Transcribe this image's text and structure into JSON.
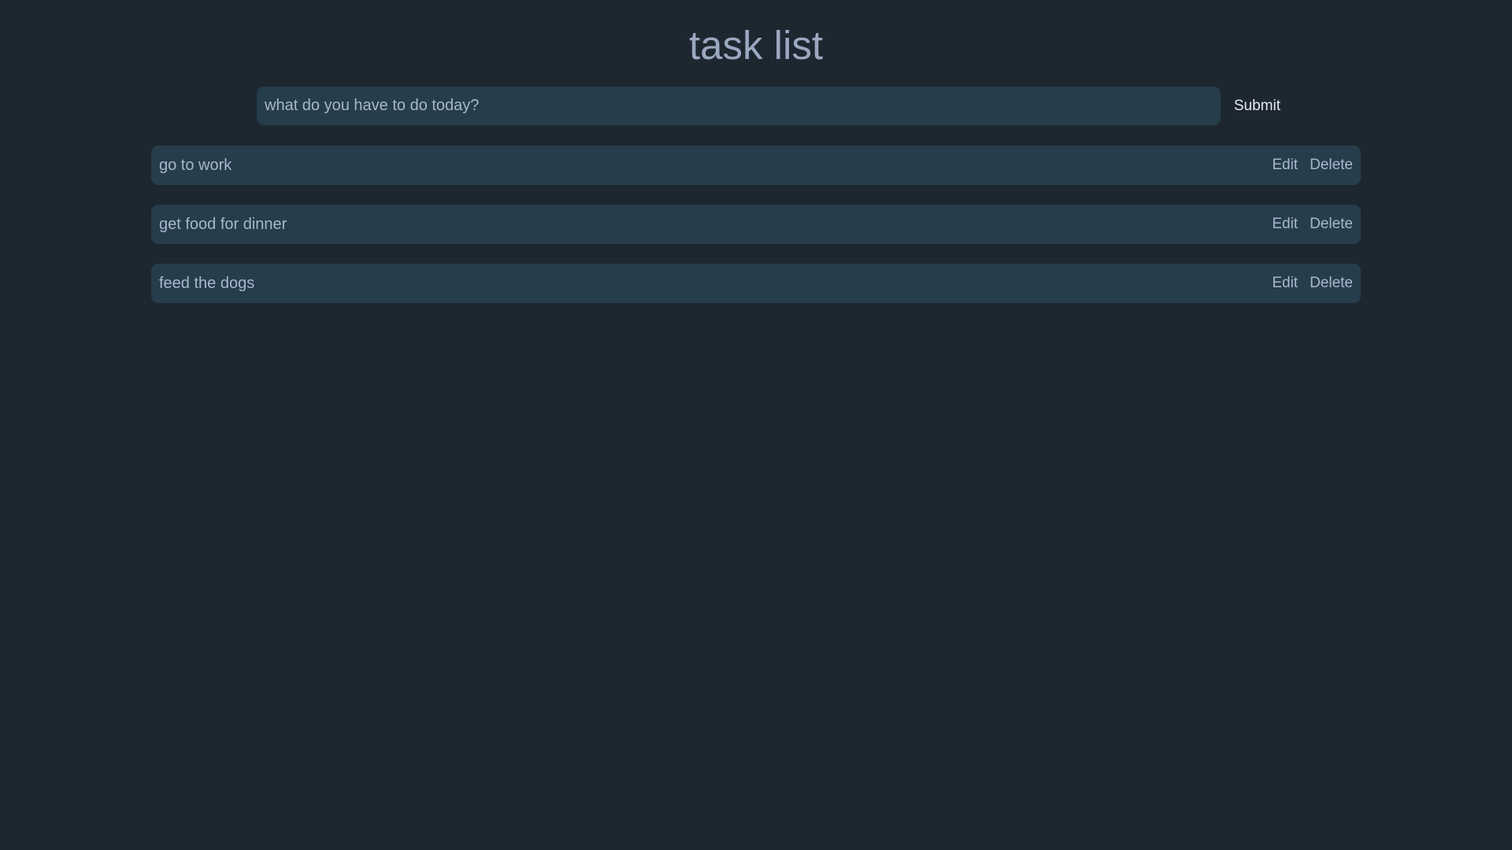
{
  "header": {
    "title": "task list"
  },
  "form": {
    "placeholder": "what do you have to do today?",
    "value": "",
    "submit_label": "Submit"
  },
  "tasks": [
    {
      "text": "go to work",
      "edit_label": "Edit",
      "delete_label": "Delete"
    },
    {
      "text": "get food for dinner",
      "edit_label": "Edit",
      "delete_label": "Delete"
    },
    {
      "text": "feed the dogs",
      "edit_label": "Edit",
      "delete_label": "Delete"
    }
  ],
  "colors": {
    "background": "#1d2730",
    "surface": "#263d4b",
    "text": "#a9b7cc",
    "title": "#9aa8c0",
    "submit_text": "#e4e8ee"
  }
}
